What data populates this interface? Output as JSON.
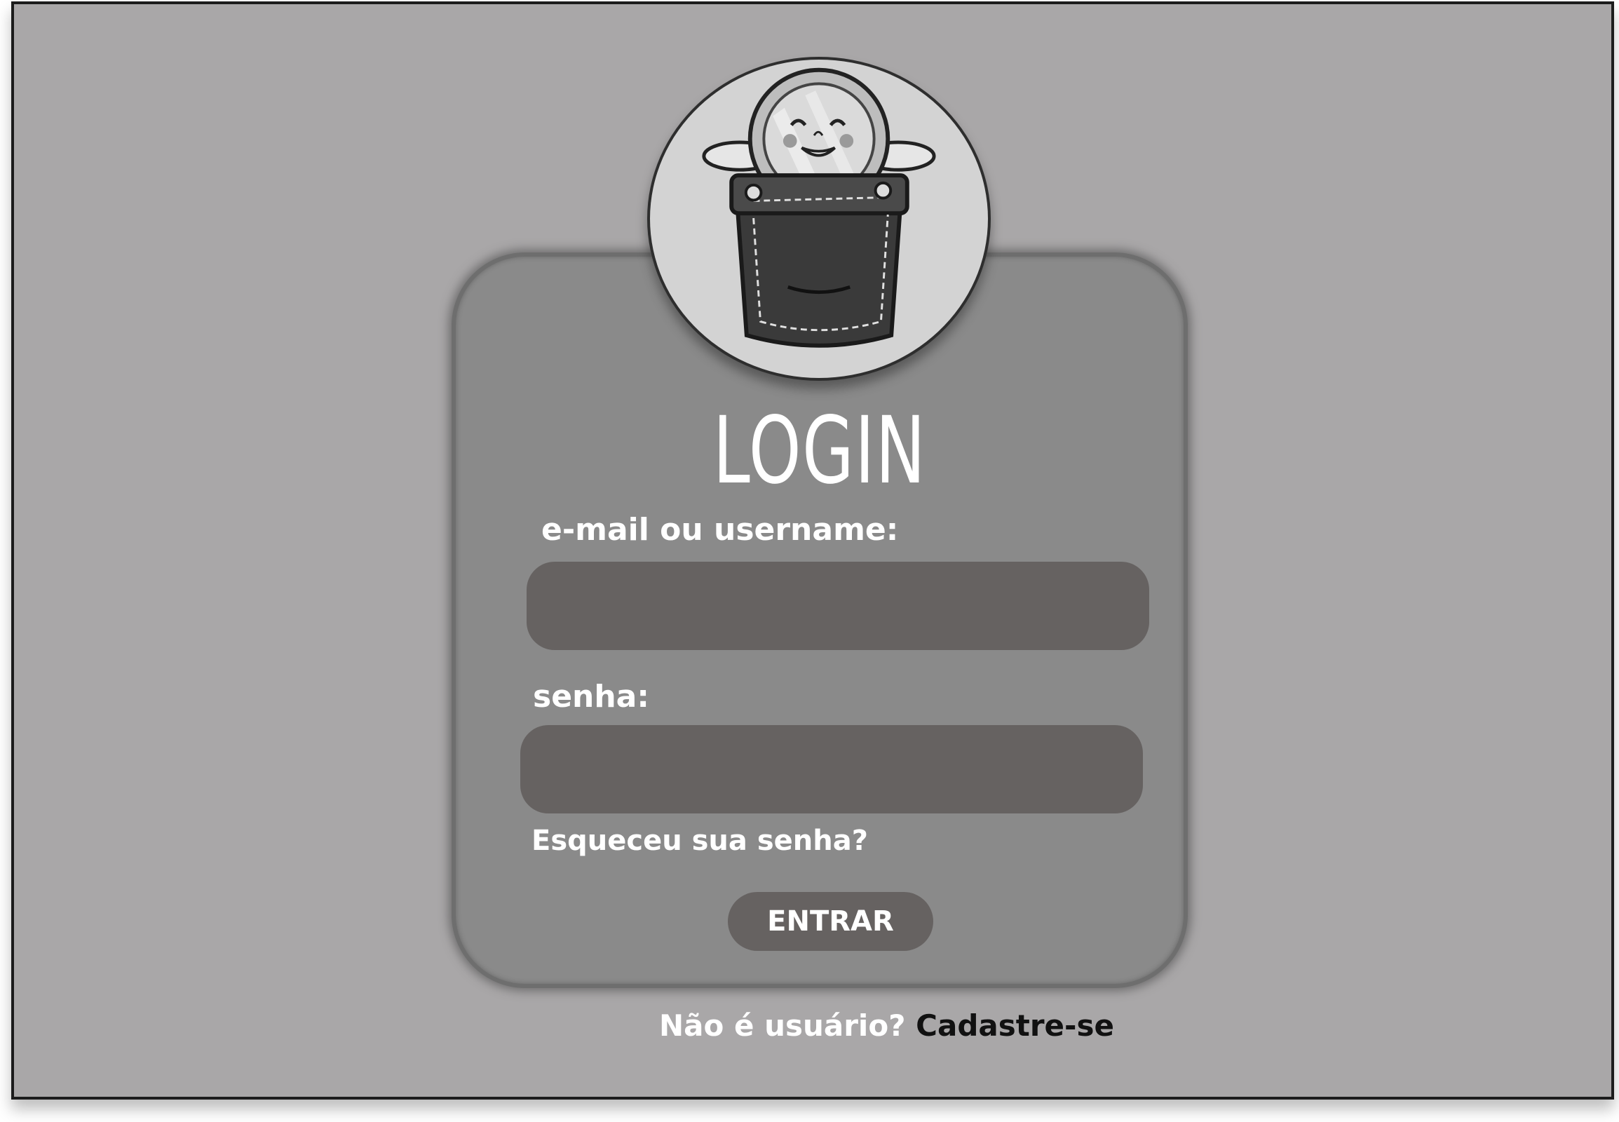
{
  "login": {
    "title": "LOGIN",
    "email_label": "e-mail ou username:",
    "email_value": "",
    "password_label": "senha:",
    "password_value": "",
    "forgot_password": "Esqueceu sua senha?",
    "enter_button": "ENTRAR",
    "signup_question": "Não é usuário?",
    "signup_link": "Cadastre-se"
  },
  "colors": {
    "background": "#a9a7a8",
    "card": "#8a8a8a",
    "field": "#666261",
    "text": "#ffffff",
    "link_dark": "#111111"
  },
  "icons": {
    "logo": "coin-in-pocket-mascot"
  }
}
